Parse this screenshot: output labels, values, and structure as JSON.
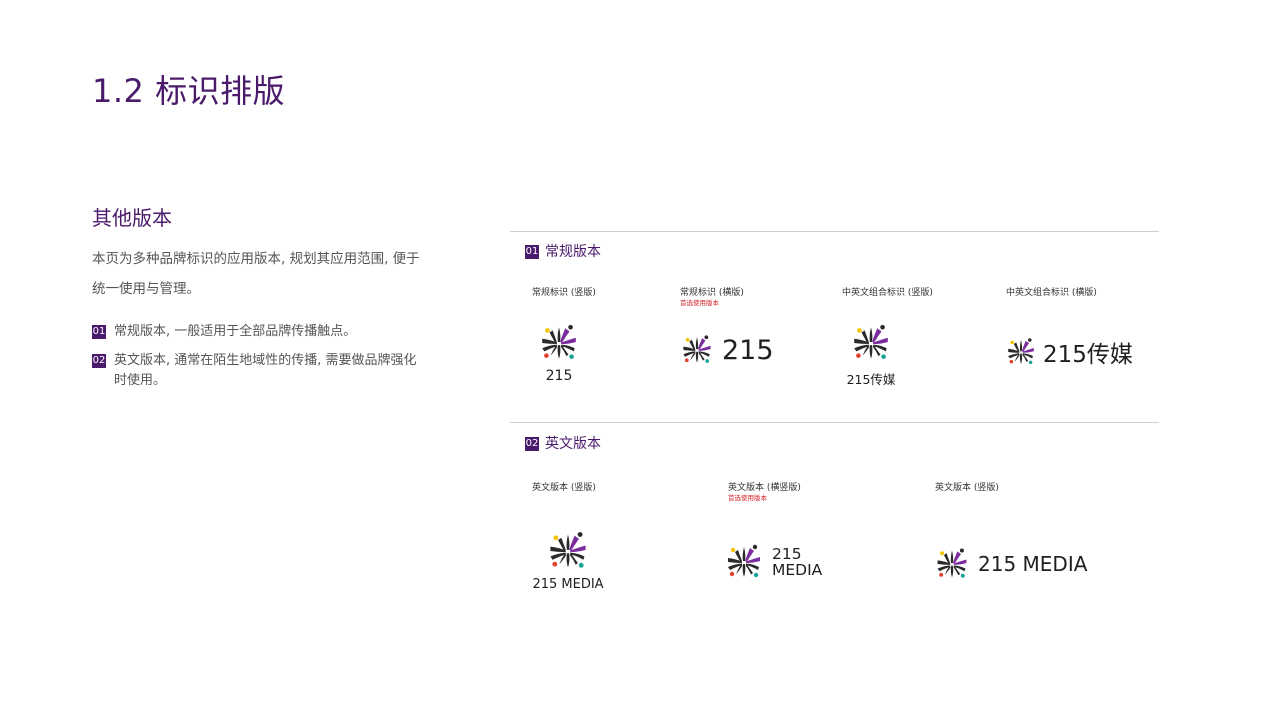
{
  "page": {
    "title": "1.2 标识排版",
    "section_title": "其他版本",
    "intro": "本页为多种品牌标识的应用版本, 规划其应用范围, 便于统一使用与管理。"
  },
  "points": [
    {
      "num": "01",
      "text": "常规版本, 一般适用于全部品牌传播触点。"
    },
    {
      "num": "02",
      "text": "英文版本, 通常在陌生地域性的传播, 需要做品牌强化时使用。"
    }
  ],
  "groups": [
    {
      "num": "01",
      "title": "常规版本",
      "items": [
        {
          "label": "常规标识 (竖版)",
          "note": "",
          "wordmark": "215"
        },
        {
          "label": "常规标识 (横版)",
          "note": "首选使用版本",
          "wordmark": "215"
        },
        {
          "label": "中英文组合标识 (竖版)",
          "note": "",
          "wordmark": "215传媒"
        },
        {
          "label": "中英文组合标识 (横版)",
          "note": "",
          "wordmark": "215传媒"
        }
      ]
    },
    {
      "num": "02",
      "title": "英文版本",
      "items": [
        {
          "label": "英文版本 (竖版)",
          "note": "",
          "wordmark": "215 MEDIA"
        },
        {
          "label": "英文版本 (横竖版)",
          "note": "首选使用版本",
          "wordmark_line1": "215",
          "wordmark_line2": "MEDIA"
        },
        {
          "label": "英文版本 (竖版)",
          "note": "",
          "wordmark": "215 MEDIA"
        }
      ]
    }
  ],
  "colors": {
    "brand_purple": "#4a1a6b",
    "mark_dark": "#2a2a2a",
    "mark_purple": "#7b2d9c",
    "dot_yellow": "#f2c500",
    "dot_red": "#e2412f",
    "dot_teal": "#1aa39a",
    "note_red": "#d21f26"
  },
  "icons": {
    "brand_mark": "asterisk-cross-logo-icon"
  }
}
